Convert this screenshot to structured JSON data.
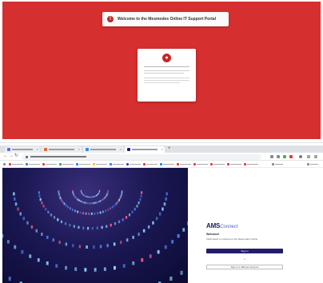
{
  "portal": {
    "banner_text": "Welcome to the Mesmodes Online IT Support Portal",
    "banner_icon": "alert-icon",
    "card_icon": "lock-icon",
    "background_color": "#d62f2f"
  },
  "browser": {
    "tab_count": 4,
    "new_tab_label": "+",
    "nav": {
      "back": "←",
      "forward": "→",
      "reload": "↻"
    }
  },
  "signin": {
    "logo_bold": "AMS",
    "logo_light": "Connect",
    "welcome_title": "Welcome!",
    "welcome_sub": "Click below to continue to the Mesmodes Online",
    "primary_button": "Sign in",
    "or_text": "or",
    "secondary_button": "Sign in a different account"
  }
}
